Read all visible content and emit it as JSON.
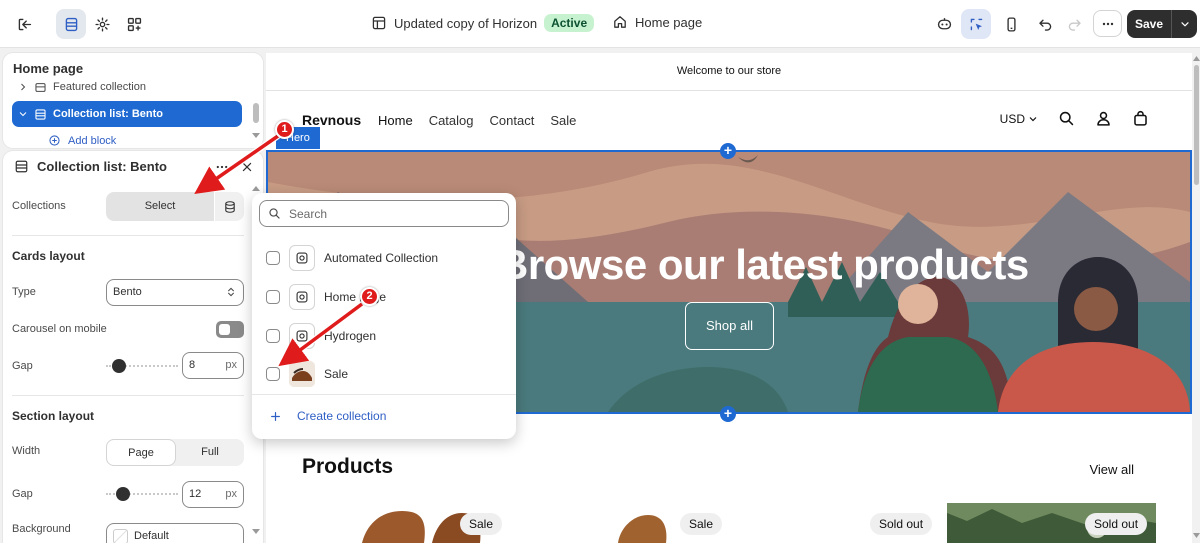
{
  "topbar": {
    "theme_name": "Updated copy of Horizon",
    "theme_status": "Active",
    "page_name": "Home page",
    "save_label": "Save"
  },
  "sidebar": {
    "title": "Home page",
    "items": [
      {
        "label": "Featured collection"
      },
      {
        "label": "Collection list: Bento"
      }
    ],
    "add_block": "Add block"
  },
  "settings": {
    "title": "Collection list: Bento",
    "collections_label": "Collections",
    "select_label": "Select",
    "cards_layout_heading": "Cards layout",
    "type_label": "Type",
    "type_value": "Bento",
    "carousel_label": "Carousel on mobile",
    "carousel_on": false,
    "gap_label": "Gap",
    "gap_value": "8",
    "gap_fraction": 0.1,
    "unit": "px",
    "section_layout_heading": "Section layout",
    "width_label": "Width",
    "width_options": [
      "Page",
      "Full"
    ],
    "width_selected": "Page",
    "section_gap_label": "Gap",
    "section_gap_value": "12",
    "section_gap_fraction": 0.17,
    "background_label": "Background",
    "background_value": "Default"
  },
  "collection_picker": {
    "search_placeholder": "Search",
    "collections": [
      {
        "name": "Automated Collection",
        "checked": false
      },
      {
        "name": "Home page",
        "checked": false
      },
      {
        "name": "Hydrogen",
        "checked": false
      },
      {
        "name": "Sale",
        "checked": false
      }
    ],
    "create_label": "Create collection"
  },
  "preview": {
    "announcement": "Welcome to our store",
    "store_name": "Revnous",
    "nav": [
      "Home",
      "Catalog",
      "Contact",
      "Sale"
    ],
    "currency": "USD",
    "hero_tag": "Hero",
    "hero_heading": "Browse our latest products",
    "hero_button": "Shop all",
    "products_heading": "Products",
    "view_all": "View all",
    "product_badges": [
      "Sale",
      "Sale",
      "Sold out",
      "Sold out"
    ]
  },
  "annotations": [
    "1",
    "2"
  ],
  "colors": {
    "accent": "#1f6ad2",
    "annotation": "#e01b1b",
    "badge_active_bg": "#c7f2cf"
  }
}
